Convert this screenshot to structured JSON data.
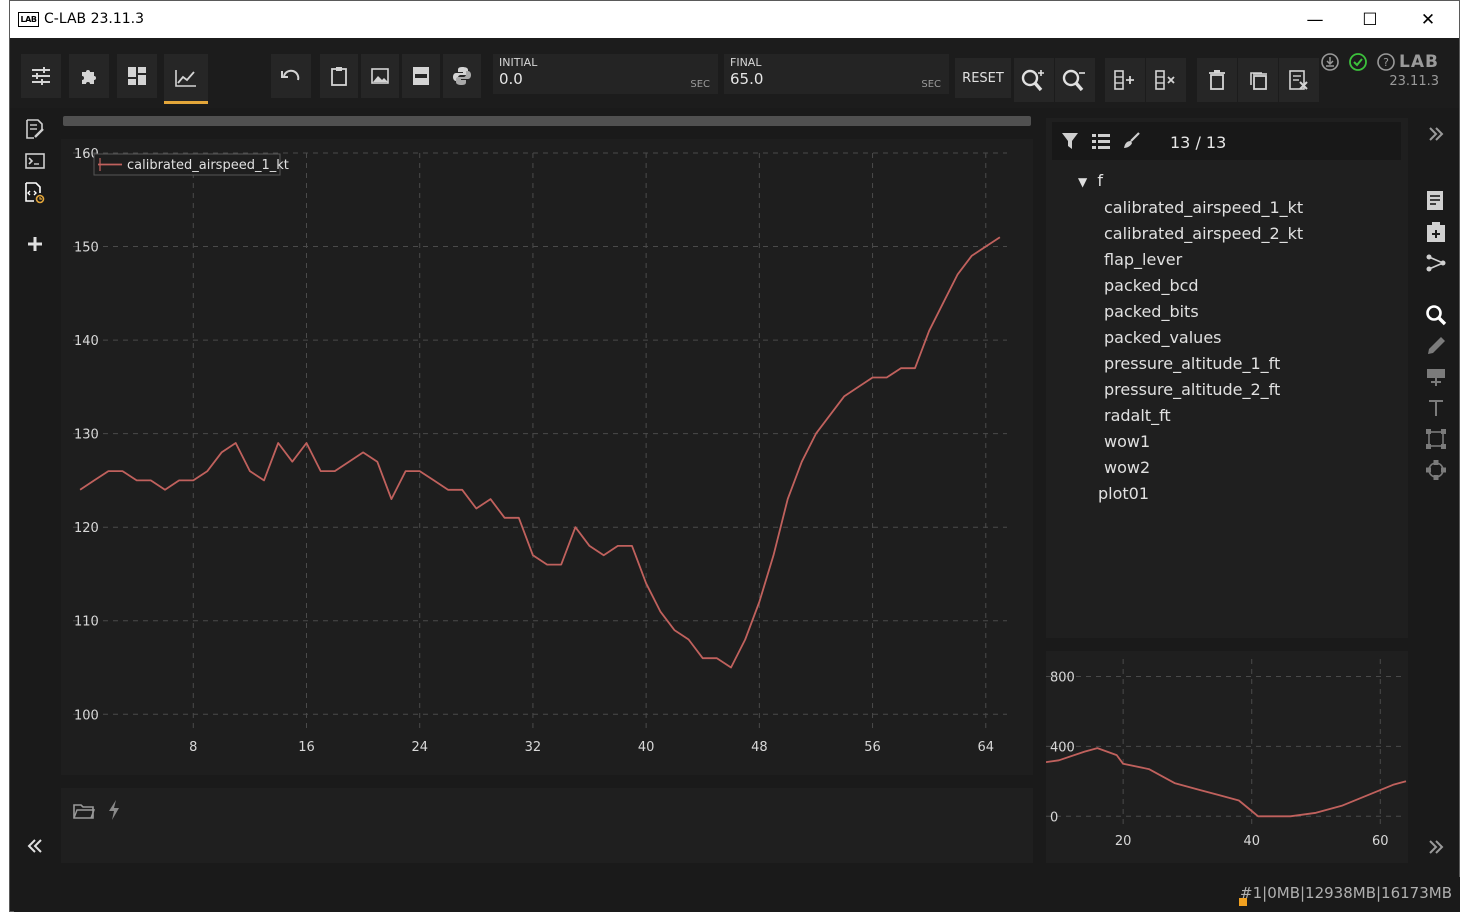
{
  "window": {
    "title": "C-LAB 23.11.3",
    "logo_text": "LAB",
    "controls": {
      "minimize": "—",
      "maximize": "☐",
      "close": "✕"
    }
  },
  "toolbar": {
    "initial": {
      "label": "INITIAL",
      "value": "0.0",
      "unit": "SEC"
    },
    "final": {
      "label": "FINAL",
      "value": "65.0",
      "unit": "SEC"
    },
    "reset_label": "RESET",
    "version_logo": "LAB",
    "version_text": "23.11.3",
    "accent_color": "#e3a63a"
  },
  "tree": {
    "count": "13 / 13",
    "root": "f",
    "items": [
      "calibrated_airspeed_1_kt",
      "calibrated_airspeed_2_kt",
      "flap_lever",
      "packed_bcd",
      "packed_bits",
      "packed_values",
      "pressure_altitude_1_ft",
      "pressure_altitude_2_ft",
      "radalt_ft",
      "wow1",
      "wow2"
    ],
    "plot_node": "plot01"
  },
  "statusbar": {
    "text": "#1|0MB|12938MB|16173MB"
  },
  "chart_data": [
    {
      "type": "line",
      "title": "",
      "xlabel": "",
      "ylabel": "",
      "legend": "top-left",
      "grid": true,
      "xlim": [
        -0.5,
        65.5
      ],
      "ylim": [
        98,
        160
      ],
      "xticks": [
        "8",
        "16",
        "24",
        "32",
        "40",
        "48",
        "56",
        "64"
      ],
      "yticks": [
        "100",
        "110",
        "120",
        "130",
        "140",
        "150",
        "160"
      ],
      "series": [
        {
          "name": "calibrated_airspeed_1_kt",
          "color": "#c0615d",
          "x": [
            0,
            1,
            2,
            3,
            4,
            5,
            6,
            7,
            8,
            9,
            10,
            11,
            12,
            13,
            14,
            15,
            16,
            17,
            18,
            19,
            20,
            21,
            22,
            23,
            24,
            25,
            26,
            27,
            28,
            29,
            30,
            31,
            32,
            33,
            34,
            35,
            36,
            37,
            38,
            39,
            40,
            41,
            42,
            43,
            44,
            45,
            46,
            47,
            48,
            49,
            50,
            51,
            52,
            53,
            54,
            55,
            56,
            57,
            58,
            59,
            60,
            61,
            62,
            63,
            64,
            65
          ],
          "y": [
            124,
            125,
            126,
            126,
            125,
            125,
            124,
            125,
            125,
            126,
            128,
            129,
            126,
            125,
            129,
            127,
            129,
            126,
            126,
            127,
            128,
            127,
            123,
            126,
            126,
            125,
            124,
            124,
            122,
            123,
            121,
            121,
            117,
            116,
            116,
            120,
            118,
            117,
            118,
            118,
            114,
            111,
            109,
            108,
            106,
            106,
            105,
            108,
            112,
            117,
            123,
            127,
            130,
            132,
            134,
            135,
            136,
            136,
            137,
            137,
            141,
            144,
            147,
            149,
            150,
            151
          ]
        }
      ]
    },
    {
      "type": "line",
      "title": "",
      "xlabel": "",
      "ylabel": "",
      "grid": true,
      "xlim": [
        8,
        64
      ],
      "ylim": [
        -50,
        900
      ],
      "xticks": [
        "20",
        "40",
        "60"
      ],
      "yticks": [
        "0",
        "400",
        "800"
      ],
      "series": [
        {
          "color": "#c0615d",
          "x": [
            8,
            10,
            14,
            16,
            19,
            20,
            24,
            28,
            32,
            35,
            38,
            40,
            41,
            44,
            46,
            50,
            54,
            58,
            62,
            64
          ],
          "y": [
            310,
            320,
            370,
            390,
            350,
            300,
            270,
            190,
            150,
            120,
            90,
            30,
            0,
            0,
            0,
            20,
            60,
            120,
            180,
            200
          ]
        }
      ]
    }
  ]
}
